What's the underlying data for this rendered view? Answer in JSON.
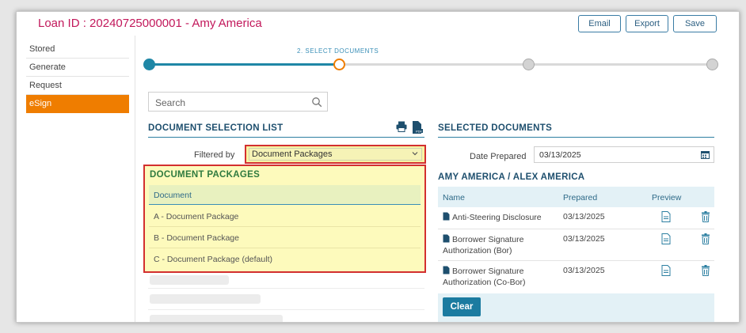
{
  "header": {
    "title": "Loan ID : 20240725000001  - Amy America",
    "buttons": {
      "email": "Email",
      "export": "Export",
      "save": "Save"
    }
  },
  "sidebar": {
    "items": [
      {
        "label": "Stored",
        "active": false
      },
      {
        "label": "Generate",
        "active": false
      },
      {
        "label": "Request",
        "active": false
      },
      {
        "label": "eSign",
        "active": true
      }
    ]
  },
  "stepper": {
    "current_label": "2. SELECT DOCUMENTS",
    "current_step": 2,
    "total_steps": 4
  },
  "search": {
    "placeholder": "Search"
  },
  "left": {
    "heading": "DOCUMENT SELECTION LIST",
    "filter_label": "Filtered by",
    "filter_value": "Document Packages",
    "packages": {
      "title": "DOCUMENT PACKAGES",
      "column": "Document",
      "rows": [
        "A - Document Package",
        "B - Document Package",
        "C - Document Package (default)"
      ]
    }
  },
  "right": {
    "heading": "SELECTED DOCUMENTS",
    "date_label": "Date Prepared",
    "date_value": "03/13/2025",
    "borrowers_heading": "AMY AMERICA / ALEX AMERICA",
    "columns": {
      "name": "Name",
      "prepared": "Prepared",
      "preview": "Preview"
    },
    "rows": [
      {
        "name": "Anti-Steering Disclosure",
        "prepared": "03/13/2025"
      },
      {
        "name": "Borrower Signature Authorization (Bor)",
        "prepared": "03/13/2025"
      },
      {
        "name": "Borrower Signature Authorization (Co-Bor)",
        "prepared": "03/13/2025"
      }
    ],
    "clear_label": "Clear"
  },
  "colors": {
    "title": "#c2185b",
    "accent": "#1f87a6",
    "active_tab": "#ef7d00",
    "highlight_border": "#d32f2f",
    "highlight_fill": "#fdfabc"
  }
}
